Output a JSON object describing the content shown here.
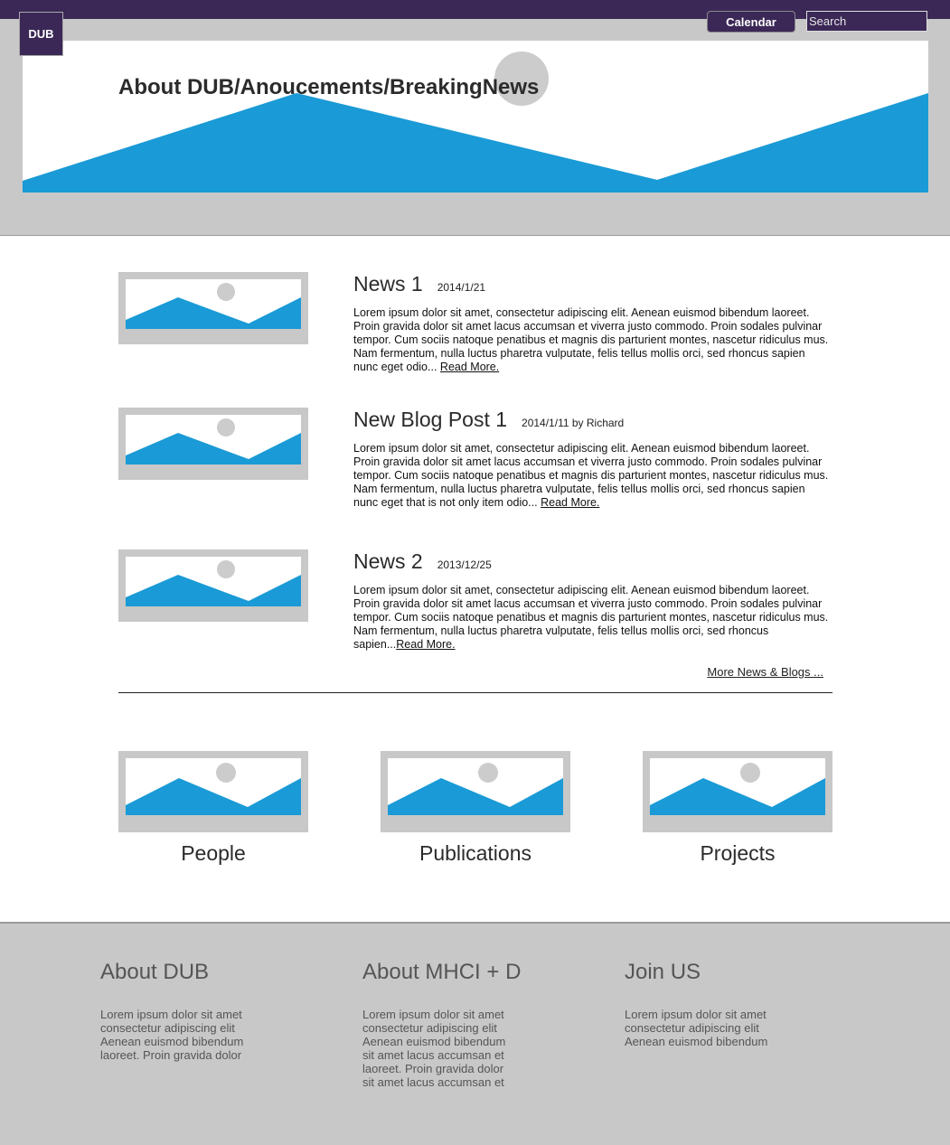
{
  "header": {
    "logo": "DUB",
    "calendar_label": "Calendar",
    "search_placeholder": "Search",
    "banner_title": "About DUB/Anoucements/BreakingNews",
    "accent_color": "#3b2857",
    "banner_color": "#1a9ad6"
  },
  "news": [
    {
      "title": "News 1",
      "meta": "2014/1/21",
      "text": "Lorem ipsum dolor sit amet, consectetur adipiscing elit. Aenean euismod bibendum laoreet. Proin gravida dolor sit amet lacus accumsan et viverra justo commodo. Proin sodales pulvinar tempor. Cum sociis natoque penatibus et magnis dis parturient montes, nascetur ridiculus mus. Nam fermentum, nulla luctus pharetra vulputate, felis tellus mollis orci, sed rhoncus sapien nunc eget odio...",
      "read_more": "Read More."
    },
    {
      "title": "New Blog Post 1",
      "meta": "2014/1/11 by Richard",
      "text": "Lorem ipsum dolor sit amet, consectetur adipiscing elit. Aenean euismod bibendum laoreet. Proin gravida dolor sit amet lacus accumsan et viverra justo commodo. Proin sodales pulvinar tempor. Cum sociis natoque penatibus et magnis dis parturient montes, nascetur ridiculus mus. Nam fermentum, nulla luctus pharetra vulputate, felis tellus mollis orci, sed rhoncus sapien nunc eget that is not only item odio...",
      "read_more": "Read More."
    },
    {
      "title": "News 2",
      "meta": "2013/12/25",
      "text": "Lorem ipsum dolor sit amet, consectetur adipiscing elit. Aenean euismod bibendum laoreet. Proin gravida dolor sit amet lacus accumsan et viverra justo commodo. Proin sodales pulvinar tempor. Cum sociis natoque penatibus et magnis dis parturient montes, nascetur ridiculus mus. Nam fermentum, nulla luctus pharetra vulputate, felis tellus mollis orci, sed rhoncus sapien...",
      "read_more": "Read More."
    }
  ],
  "more_news": "More News & Blogs ...",
  "sections": [
    {
      "label": "People"
    },
    {
      "label": "Publications"
    },
    {
      "label": "Projects"
    }
  ],
  "footer": [
    {
      "title": "About DUB",
      "text": "Lorem ipsum dolor sit amet consectetur adipiscing elit Aenean euismod bibendum laoreet. Proin gravida dolor"
    },
    {
      "title": "About MHCI + D",
      "text": "Lorem ipsum dolor sit amet consectetur adipiscing elit Aenean euismod bibendum sit amet lacus accumsan et laoreet. Proin gravida dolor sit amet lacus accumsan et"
    },
    {
      "title": "Join US",
      "text": "Lorem ipsum dolor sit amet consectetur adipiscing elit Aenean euismod bibendum"
    }
  ]
}
